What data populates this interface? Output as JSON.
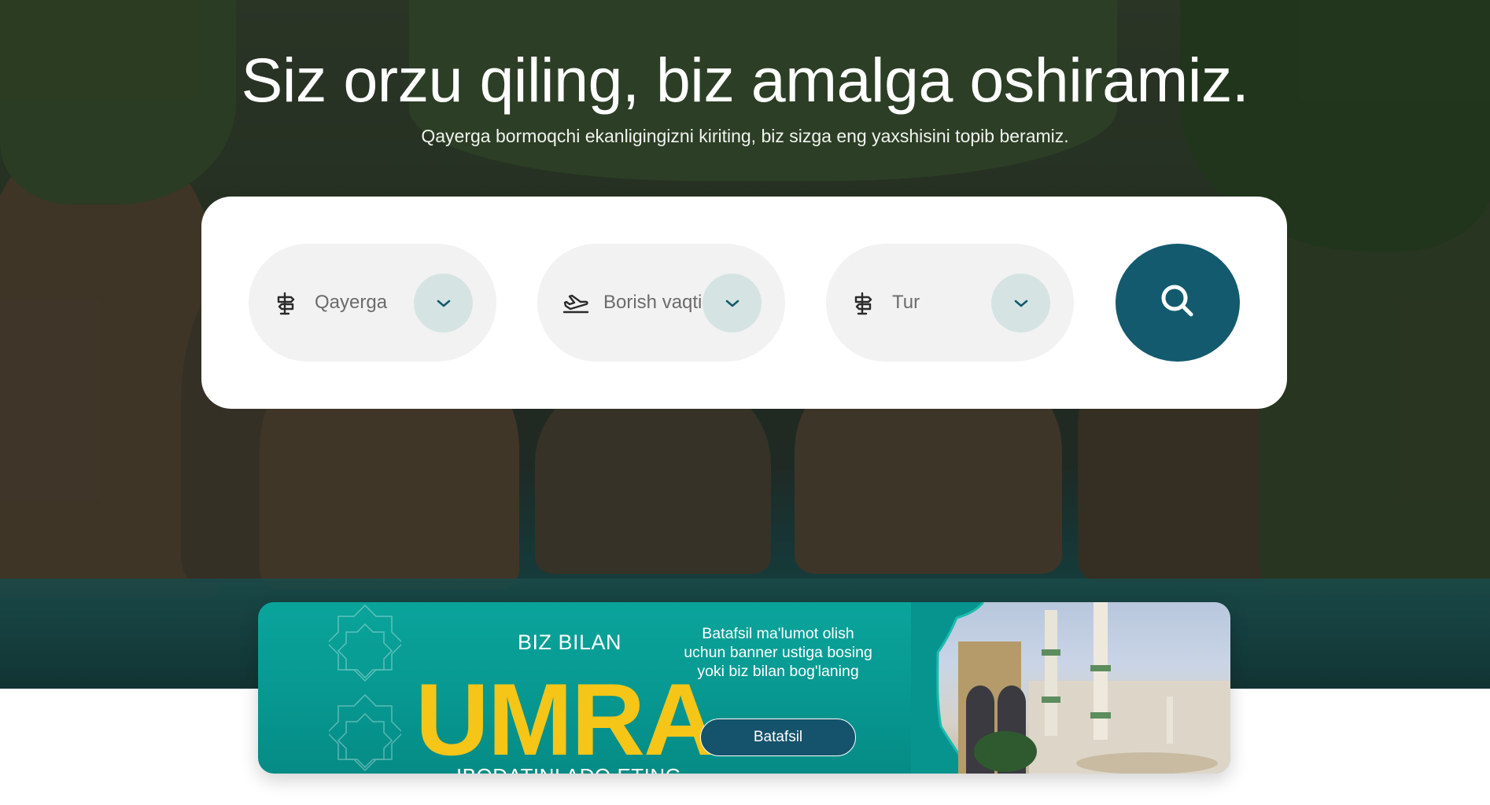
{
  "hero": {
    "title": "Siz orzu qiling, biz amalga oshiramiz.",
    "subtitle": "Qayerga bormoqchi ekanligingizni kiriting, biz sizga eng yaxshisini topib beramiz."
  },
  "search": {
    "fields": [
      {
        "label": "Qayerga",
        "icon": "signpost-icon"
      },
      {
        "label": "Borish vaqti",
        "icon": "airplane-takeoff-icon"
      },
      {
        "label": "Tur",
        "icon": "signpost-icon"
      }
    ],
    "button_icon": "search-icon"
  },
  "banner": {
    "line1": "BIZ BILAN",
    "headline": "UMRA",
    "line2": "IBODATINI ADO ETING",
    "info": "Batafsil ma'lumot olish uchun banner ustiga bosing yoki biz bilan bog'laning",
    "button_label": "Batafsil"
  },
  "colors": {
    "primary": "#135a6e",
    "chevron_bg": "#d5e4e2",
    "field_bg": "#f2f2f2",
    "banner_teal": "#0aa49b",
    "umra_yellow": "#f5c518"
  }
}
